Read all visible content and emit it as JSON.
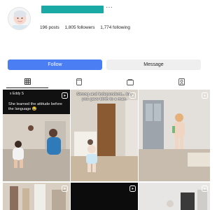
{
  "profile": {
    "stats": {
      "posts": "196 posts",
      "followers": "1,805 followers",
      "following": "1,774 following"
    },
    "more_icon": "ellipsis-icon",
    "avatar_icon": "avatar"
  },
  "buttons": {
    "follow": "Follow",
    "message": "Message"
  },
  "tabs": [
    {
      "icon": "grid-icon",
      "active": true
    },
    {
      "icon": "reels-icon",
      "active": false
    },
    {
      "icon": "guide-icon",
      "active": false
    },
    {
      "icon": "tagged-icon",
      "active": false
    }
  ],
  "posts": [
    {
      "account": "x Eddy S",
      "caption": "She learned the attitude before the language 😂",
      "type": "reel"
    },
    {
      "caption": "Strong and independent... but you gave birth to a man.",
      "type": "reel"
    },
    {
      "caption": "",
      "type": "reel"
    },
    {
      "caption": "",
      "type": "reel"
    },
    {
      "caption": "",
      "type": "reel"
    },
    {
      "caption": "",
      "type": "reel"
    }
  ],
  "colors": {
    "accent": "#4a7ef2",
    "username_bar": "#1aa9a4"
  }
}
